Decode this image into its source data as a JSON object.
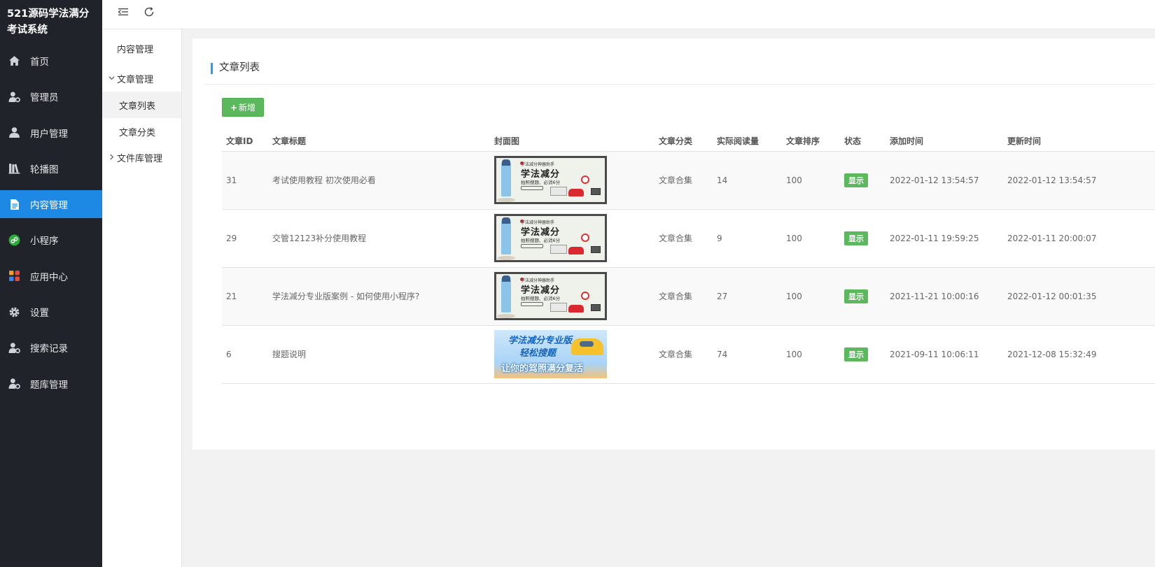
{
  "sidebar": {
    "brand": "521源码学法满分考试系统",
    "items": [
      {
        "label": "首页",
        "icon": "home-icon"
      },
      {
        "label": "管理员",
        "icon": "user-gear-icon"
      },
      {
        "label": "用户管理",
        "icon": "user-icon"
      },
      {
        "label": "轮播图",
        "icon": "books-icon"
      },
      {
        "label": "内容管理",
        "icon": "document-icon"
      },
      {
        "label": "小程序",
        "icon": "miniprogram-icon"
      },
      {
        "label": "应用中心",
        "icon": "apps-icon"
      },
      {
        "label": "设置",
        "icon": "gear-icon"
      },
      {
        "label": "搜索记录",
        "icon": "user-gear-icon"
      },
      {
        "label": "题库管理",
        "icon": "user-gear-icon"
      }
    ],
    "active": "内容管理"
  },
  "topbar": {
    "collapse_icon": "menu-collapse-icon",
    "refresh_icon": "refresh-icon"
  },
  "subnav": {
    "title": "内容管理",
    "group1": "文章管理",
    "group1_items": [
      "文章列表",
      "文章分类"
    ],
    "group2": "文件库管理",
    "active": "文章列表"
  },
  "panel": {
    "title": "文章列表",
    "add_label": "新增"
  },
  "table": {
    "headers": [
      "文章ID",
      "文章标题",
      "封面图",
      "文章分类",
      "实际阅读量",
      "文章排序",
      "状态",
      "添加时间",
      "更新时间"
    ],
    "rows": [
      {
        "id": "31",
        "title": "考试使用教程 初次使用必看",
        "category": "文章合集",
        "views": "14",
        "sort": "100",
        "status": "显示",
        "added": "2022-01-12 13:54:57",
        "updated": "2022-01-12 13:54:57"
      },
      {
        "id": "29",
        "title": "交管12123补分使用教程",
        "category": "文章合集",
        "views": "9",
        "sort": "100",
        "status": "显示",
        "added": "2022-01-11 19:59:25",
        "updated": "2022-01-11 20:00:07"
      },
      {
        "id": "21",
        "title": "学法减分专业版案例 - 如何使用小程序?",
        "category": "文章合集",
        "views": "27",
        "sort": "100",
        "status": "显示",
        "added": "2021-11-21 10:00:16",
        "updated": "2022-01-12 00:01:35"
      },
      {
        "id": "6",
        "title": "搜题说明",
        "category": "文章合集",
        "views": "74",
        "sort": "100",
        "status": "显示",
        "added": "2021-09-11 10:06:11",
        "updated": "2021-12-08 15:32:49"
      }
    ]
  },
  "covers": {
    "a": {
      "small": "学法减分神器助手",
      "big": "学法减分",
      "sub": "拍照搜题、必消6分"
    },
    "b": {
      "line1": "学法减分专业版",
      "line2": "轻松搜题",
      "line3": "让你的驾照满分复活"
    }
  },
  "colors": {
    "sidebar_bg": "#20232a",
    "active_blue": "#1e88e5",
    "accent_green": "#5cb85c"
  }
}
